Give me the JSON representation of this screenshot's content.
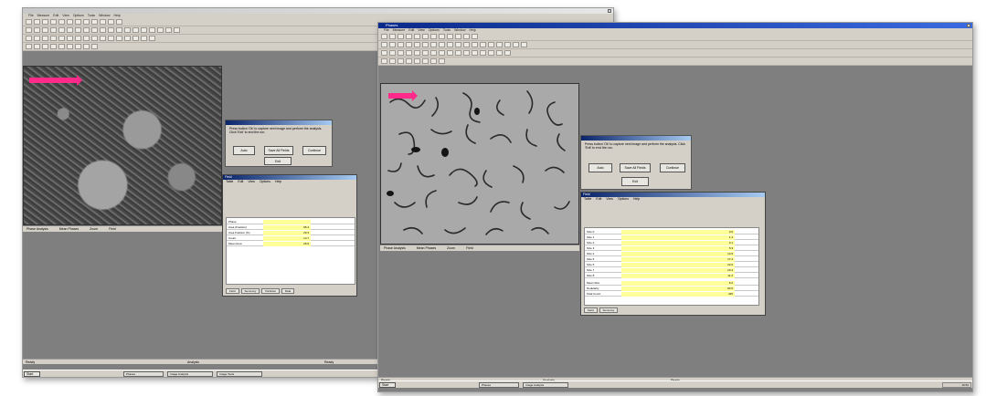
{
  "left": {
    "window_title": "",
    "menu": [
      "File",
      "Measure",
      "Edit",
      "View",
      "Options",
      "Tools",
      "Window",
      "Help"
    ],
    "dialog": {
      "message": "Press button 'Ok' to capture next image and perform the analysis. Click 'Exit' to end the run.",
      "ok_label": "Auto",
      "highlight_label": "Save All Fields",
      "continue_label": "Continue",
      "exit_label": "Exit"
    },
    "panel": {
      "title": "Field",
      "menu": [
        "Table",
        "Edit",
        "View",
        "Options",
        "Help"
      ],
      "rows": [
        {
          "label": "Phase",
          "value": ""
        },
        {
          "label": "Area (Fraction)",
          "value": "95.4"
        },
        {
          "label": "Area Fraction (%)",
          "value": "20.3"
        },
        {
          "label": "Count",
          "value": "14.7"
        },
        {
          "label": "Mean Area",
          "value": "26.9"
        }
      ],
      "tabs": [
        "Field",
        "Summary",
        "Particles",
        "Data"
      ]
    },
    "viewer_status": [
      "Phase Analysis",
      "Mean Phases",
      "Zoom",
      "Field"
    ],
    "status": {
      "left": "Ready",
      "center": "Analysis",
      "right": "Ready"
    },
    "taskbar": {
      "start": "Start",
      "tasks": [
        "Phases",
        "Image Analysis",
        "Image Tools"
      ],
      "tray": "10:45"
    }
  },
  "right": {
    "window_title": "Phases",
    "menu": [
      "File",
      "Measure",
      "Edit",
      "View",
      "Options",
      "Tools",
      "Window",
      "Help"
    ],
    "dialog": {
      "message": "Press button 'Ok' to capture next image and perform the analysis. Click 'Exit' to end the run.",
      "ok_label": "Auto",
      "highlight_label": "Save All Fields",
      "continue_label": "Continue",
      "exit_label": "Exit"
    },
    "panel": {
      "title": "Field",
      "menu": [
        "Table",
        "Edit",
        "View",
        "Options",
        "Help"
      ],
      "rows": [
        {
          "label": "Size 0",
          "value": "0.6"
        },
        {
          "label": "Size 1",
          "value": "1.4"
        },
        {
          "label": "Size 2",
          "value": "3.1"
        },
        {
          "label": "Size 3",
          "value": "5.3"
        },
        {
          "label": "Size 4",
          "value": "12.5"
        },
        {
          "label": "Size 5",
          "value": "17.4"
        },
        {
          "label": "Size 6",
          "value": "22.0"
        },
        {
          "label": "Size 7",
          "value": "20.4"
        },
        {
          "label": "Size 8",
          "value": "11.2"
        },
        {
          "label": "Mean Size",
          "value": "5.2"
        },
        {
          "label": "Nodularity",
          "value": "82.6"
        },
        {
          "label": "Total Count",
          "value": "425"
        }
      ],
      "tabs": [
        "Field",
        "Summary"
      ]
    },
    "viewer_status": [
      "Phase Analysis",
      "Mean Phases",
      "Zoom",
      "Field"
    ],
    "status": {
      "left": "Ready",
      "center": "Analysis",
      "right": "Ready"
    },
    "taskbar": {
      "start": "Start",
      "tasks": [
        "Phases",
        "Image Analysis"
      ],
      "tray": "10:52"
    }
  }
}
